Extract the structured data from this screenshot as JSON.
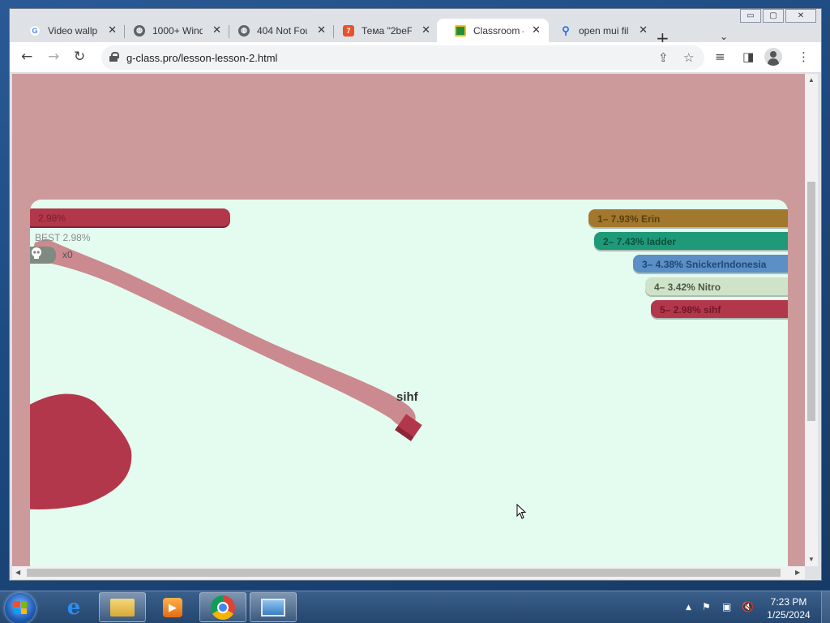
{
  "browser": {
    "window_controls": {
      "minimize": "▭",
      "maximize": "▢",
      "close": "✕"
    },
    "tabs": [
      {
        "label": "Video wallp",
        "favicon": "google-icon",
        "active": false
      },
      {
        "label": "1000+ Wind",
        "favicon": "globe-icon",
        "active": false
      },
      {
        "label": "404 Not Fou",
        "favicon": "globe-icon",
        "active": false
      },
      {
        "label": "Тема \"2beF",
        "favicon": "seven-icon",
        "active": false
      },
      {
        "label": "Classroom –",
        "favicon": "classroom-icon",
        "active": true
      },
      {
        "label": "open mui fil",
        "favicon": "search-icon",
        "active": false
      }
    ],
    "new_tab": "+",
    "tab_menu": "⌄",
    "url": "g-class.pro/lesson-lesson-2.html"
  },
  "game": {
    "progress_text": "2.98%",
    "progress_fraction": 0.0298,
    "best_text": "BEST 2.98%",
    "kills_text": "x0",
    "player_name": "sihf",
    "leaderboard": [
      {
        "text": "1– 7.93% Erin",
        "color": "#a1782e",
        "text_color": "#5a3f0e"
      },
      {
        "text": "2– 7.43% ladder",
        "color": "#1e9a78",
        "text_color": "#0c4f3b"
      },
      {
        "text": "3– 4.38% SnickerIndonesia",
        "color": "#5b8fc6",
        "text_color": "#1f4777"
      },
      {
        "text": "4– 3.42% Nitro",
        "color": "#cfe3c9",
        "text_color": "#4a5a45"
      },
      {
        "text": "5– 2.98% sihf",
        "color": "#b3374b",
        "text_color": "#6e1626"
      }
    ],
    "colors": {
      "arena": "#e4fbef",
      "outer": "#cc9a9a",
      "player": "#b3374b",
      "trail": "#cb8a8f"
    }
  },
  "taskbar": {
    "apps": [
      "internet-explorer-icon",
      "file-explorer-icon",
      "media-player-icon",
      "chrome-icon",
      "photo-viewer-icon"
    ],
    "time": "7:23 PM",
    "date": "1/25/2024"
  }
}
